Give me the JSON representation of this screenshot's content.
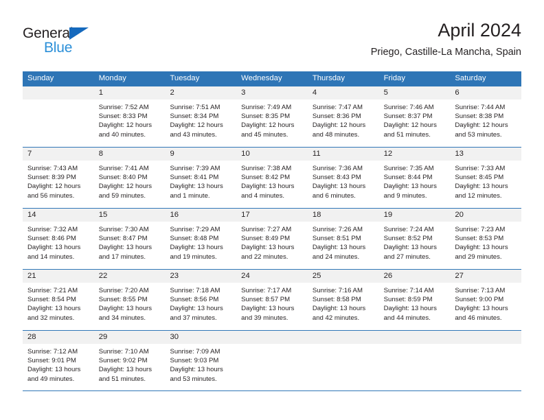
{
  "brand": {
    "name_part1": "General",
    "name_part2": "Blue",
    "triangle_color": "#1569bd",
    "blue_color": "#2b8fd8"
  },
  "header": {
    "title": "April 2024",
    "subtitle": "Priego, Castille-La Mancha, Spain"
  },
  "theme": {
    "header_blue": "#2e75b6",
    "day_number_band": "#f1f1f1",
    "text": "#231f20"
  },
  "weekdays": [
    "Sunday",
    "Monday",
    "Tuesday",
    "Wednesday",
    "Thursday",
    "Friday",
    "Saturday"
  ],
  "weeks": [
    [
      {
        "day": "",
        "lines": []
      },
      {
        "day": "1",
        "lines": [
          "Sunrise: 7:52 AM",
          "Sunset: 8:33 PM",
          "Daylight: 12 hours",
          "and 40 minutes."
        ]
      },
      {
        "day": "2",
        "lines": [
          "Sunrise: 7:51 AM",
          "Sunset: 8:34 PM",
          "Daylight: 12 hours",
          "and 43 minutes."
        ]
      },
      {
        "day": "3",
        "lines": [
          "Sunrise: 7:49 AM",
          "Sunset: 8:35 PM",
          "Daylight: 12 hours",
          "and 45 minutes."
        ]
      },
      {
        "day": "4",
        "lines": [
          "Sunrise: 7:47 AM",
          "Sunset: 8:36 PM",
          "Daylight: 12 hours",
          "and 48 minutes."
        ]
      },
      {
        "day": "5",
        "lines": [
          "Sunrise: 7:46 AM",
          "Sunset: 8:37 PM",
          "Daylight: 12 hours",
          "and 51 minutes."
        ]
      },
      {
        "day": "6",
        "lines": [
          "Sunrise: 7:44 AM",
          "Sunset: 8:38 PM",
          "Daylight: 12 hours",
          "and 53 minutes."
        ]
      }
    ],
    [
      {
        "day": "7",
        "lines": [
          "Sunrise: 7:43 AM",
          "Sunset: 8:39 PM",
          "Daylight: 12 hours",
          "and 56 minutes."
        ]
      },
      {
        "day": "8",
        "lines": [
          "Sunrise: 7:41 AM",
          "Sunset: 8:40 PM",
          "Daylight: 12 hours",
          "and 59 minutes."
        ]
      },
      {
        "day": "9",
        "lines": [
          "Sunrise: 7:39 AM",
          "Sunset: 8:41 PM",
          "Daylight: 13 hours",
          "and 1 minute."
        ]
      },
      {
        "day": "10",
        "lines": [
          "Sunrise: 7:38 AM",
          "Sunset: 8:42 PM",
          "Daylight: 13 hours",
          "and 4 minutes."
        ]
      },
      {
        "day": "11",
        "lines": [
          "Sunrise: 7:36 AM",
          "Sunset: 8:43 PM",
          "Daylight: 13 hours",
          "and 6 minutes."
        ]
      },
      {
        "day": "12",
        "lines": [
          "Sunrise: 7:35 AM",
          "Sunset: 8:44 PM",
          "Daylight: 13 hours",
          "and 9 minutes."
        ]
      },
      {
        "day": "13",
        "lines": [
          "Sunrise: 7:33 AM",
          "Sunset: 8:45 PM",
          "Daylight: 13 hours",
          "and 12 minutes."
        ]
      }
    ],
    [
      {
        "day": "14",
        "lines": [
          "Sunrise: 7:32 AM",
          "Sunset: 8:46 PM",
          "Daylight: 13 hours",
          "and 14 minutes."
        ]
      },
      {
        "day": "15",
        "lines": [
          "Sunrise: 7:30 AM",
          "Sunset: 8:47 PM",
          "Daylight: 13 hours",
          "and 17 minutes."
        ]
      },
      {
        "day": "16",
        "lines": [
          "Sunrise: 7:29 AM",
          "Sunset: 8:48 PM",
          "Daylight: 13 hours",
          "and 19 minutes."
        ]
      },
      {
        "day": "17",
        "lines": [
          "Sunrise: 7:27 AM",
          "Sunset: 8:49 PM",
          "Daylight: 13 hours",
          "and 22 minutes."
        ]
      },
      {
        "day": "18",
        "lines": [
          "Sunrise: 7:26 AM",
          "Sunset: 8:51 PM",
          "Daylight: 13 hours",
          "and 24 minutes."
        ]
      },
      {
        "day": "19",
        "lines": [
          "Sunrise: 7:24 AM",
          "Sunset: 8:52 PM",
          "Daylight: 13 hours",
          "and 27 minutes."
        ]
      },
      {
        "day": "20",
        "lines": [
          "Sunrise: 7:23 AM",
          "Sunset: 8:53 PM",
          "Daylight: 13 hours",
          "and 29 minutes."
        ]
      }
    ],
    [
      {
        "day": "21",
        "lines": [
          "Sunrise: 7:21 AM",
          "Sunset: 8:54 PM",
          "Daylight: 13 hours",
          "and 32 minutes."
        ]
      },
      {
        "day": "22",
        "lines": [
          "Sunrise: 7:20 AM",
          "Sunset: 8:55 PM",
          "Daylight: 13 hours",
          "and 34 minutes."
        ]
      },
      {
        "day": "23",
        "lines": [
          "Sunrise: 7:18 AM",
          "Sunset: 8:56 PM",
          "Daylight: 13 hours",
          "and 37 minutes."
        ]
      },
      {
        "day": "24",
        "lines": [
          "Sunrise: 7:17 AM",
          "Sunset: 8:57 PM",
          "Daylight: 13 hours",
          "and 39 minutes."
        ]
      },
      {
        "day": "25",
        "lines": [
          "Sunrise: 7:16 AM",
          "Sunset: 8:58 PM",
          "Daylight: 13 hours",
          "and 42 minutes."
        ]
      },
      {
        "day": "26",
        "lines": [
          "Sunrise: 7:14 AM",
          "Sunset: 8:59 PM",
          "Daylight: 13 hours",
          "and 44 minutes."
        ]
      },
      {
        "day": "27",
        "lines": [
          "Sunrise: 7:13 AM",
          "Sunset: 9:00 PM",
          "Daylight: 13 hours",
          "and 46 minutes."
        ]
      }
    ],
    [
      {
        "day": "28",
        "lines": [
          "Sunrise: 7:12 AM",
          "Sunset: 9:01 PM",
          "Daylight: 13 hours",
          "and 49 minutes."
        ]
      },
      {
        "day": "29",
        "lines": [
          "Sunrise: 7:10 AM",
          "Sunset: 9:02 PM",
          "Daylight: 13 hours",
          "and 51 minutes."
        ]
      },
      {
        "day": "30",
        "lines": [
          "Sunrise: 7:09 AM",
          "Sunset: 9:03 PM",
          "Daylight: 13 hours",
          "and 53 minutes."
        ]
      },
      {
        "day": "",
        "lines": []
      },
      {
        "day": "",
        "lines": []
      },
      {
        "day": "",
        "lines": []
      },
      {
        "day": "",
        "lines": []
      }
    ]
  ]
}
